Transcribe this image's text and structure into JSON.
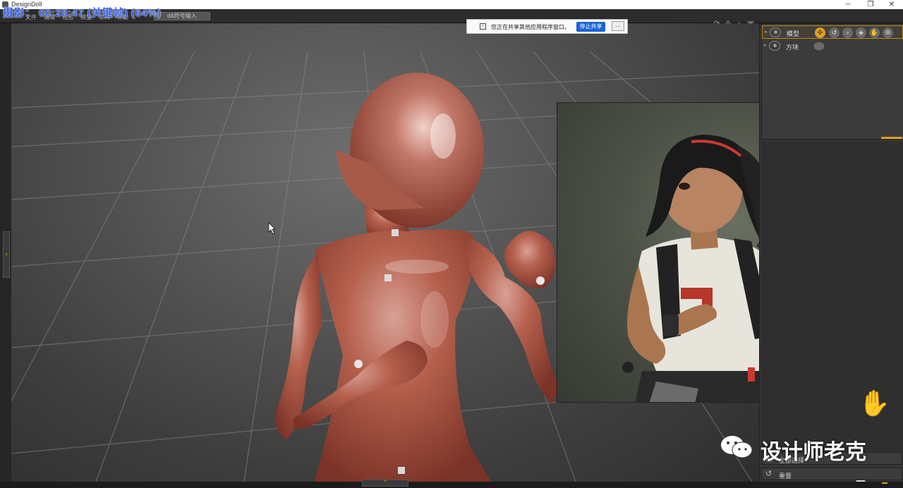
{
  "window": {
    "title": "DesignDoll",
    "minimize": "─",
    "maximize": "❐",
    "close": "✕"
  },
  "recording": {
    "overlay": "摄影： 00:28:47 (关键帧) (64%)"
  },
  "menu": {
    "items": [
      "文件",
      "编辑",
      "视图",
      "模型",
      "工具",
      "帮助"
    ],
    "search_placeholder": "d&符号输入"
  },
  "share_notice": {
    "text": "您正在共享其他应用程序窗口。",
    "stop_label": "停止共享",
    "more_label": "..."
  },
  "scene_tree": {
    "rows": [
      {
        "label": "模型",
        "selected": true
      },
      {
        "label": "方块",
        "selected": false
      }
    ]
  },
  "panel_buttons": {
    "select": "全部选择",
    "reset": "重置"
  },
  "watermark": {
    "text": "设计师老克"
  },
  "colors": {
    "accent": "#e0a020",
    "share_button": "#1a64d6",
    "recording_text": "#3a5fe0",
    "doll_skin": "#b5604d"
  },
  "icons": {
    "view_tools": [
      "rotate-icon",
      "move-icon",
      "zoom-icon",
      "camera-icon"
    ],
    "model_tools": [
      "joint-icon",
      "undo-pose-icon",
      "search-icon",
      "tag-icon",
      "hand-icon",
      "gear-icon"
    ]
  }
}
